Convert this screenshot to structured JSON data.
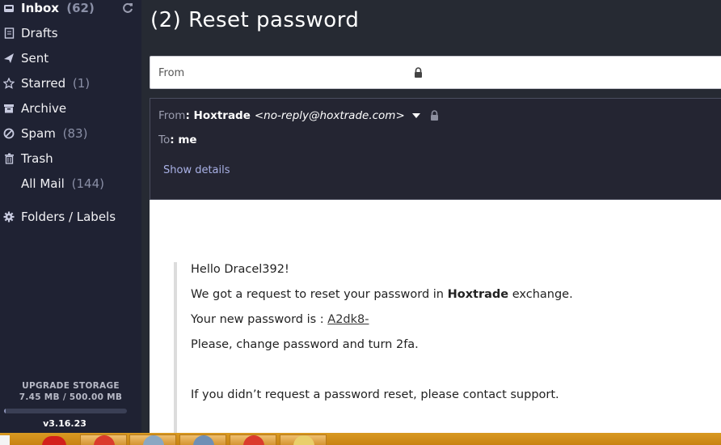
{
  "sidebar": {
    "items": [
      {
        "label": "Inbox",
        "count": "(62)",
        "icon": "inbox-icon"
      },
      {
        "label": "Drafts",
        "count": "",
        "icon": "drafts-icon"
      },
      {
        "label": "Sent",
        "count": "",
        "icon": "sent-icon"
      },
      {
        "label": "Starred",
        "count": "(1)",
        "icon": "star-icon"
      },
      {
        "label": "Archive",
        "count": "",
        "icon": "archive-icon"
      },
      {
        "label": "Spam",
        "count": "(83)",
        "icon": "spam-icon"
      },
      {
        "label": "Trash",
        "count": "",
        "icon": "trash-icon"
      },
      {
        "label": "All Mail",
        "count": "(144)",
        "icon": ""
      },
      {
        "label": "Folders / Labels",
        "count": "",
        "icon": "gear-icon"
      }
    ],
    "storage": {
      "title": "UPGRADE STORAGE",
      "usage": "7.45 MB / 500.00 MB",
      "fraction": 0.0149
    },
    "version": "v3.16.23"
  },
  "message": {
    "title": "(2) Reset password",
    "from_field_label": "From",
    "header": {
      "from_key": "From",
      "from_name": ": Hoxtrade",
      "from_email": "<no-reply@hoxtrade.com>",
      "to_key": "To",
      "to_value": ": me",
      "show_details": "Show details"
    },
    "body": {
      "greeting": "Hello Dracel392!",
      "line1_pre": "We got a request to reset your password in ",
      "line1_brand": "Hoxtrade",
      "line1_post": " exchange.",
      "line2_pre": "Your new password is : ",
      "line2_password": "A2dk8-",
      "line3": "Please, change password and turn 2fa.",
      "line4": "If you didn’t request a password reset, please contact support."
    }
  },
  "colors": {
    "sidebar_bg": "#1f2233",
    "main_bg": "#262a33",
    "link": "#a9b1e6",
    "taskbar": "#d99a22"
  }
}
